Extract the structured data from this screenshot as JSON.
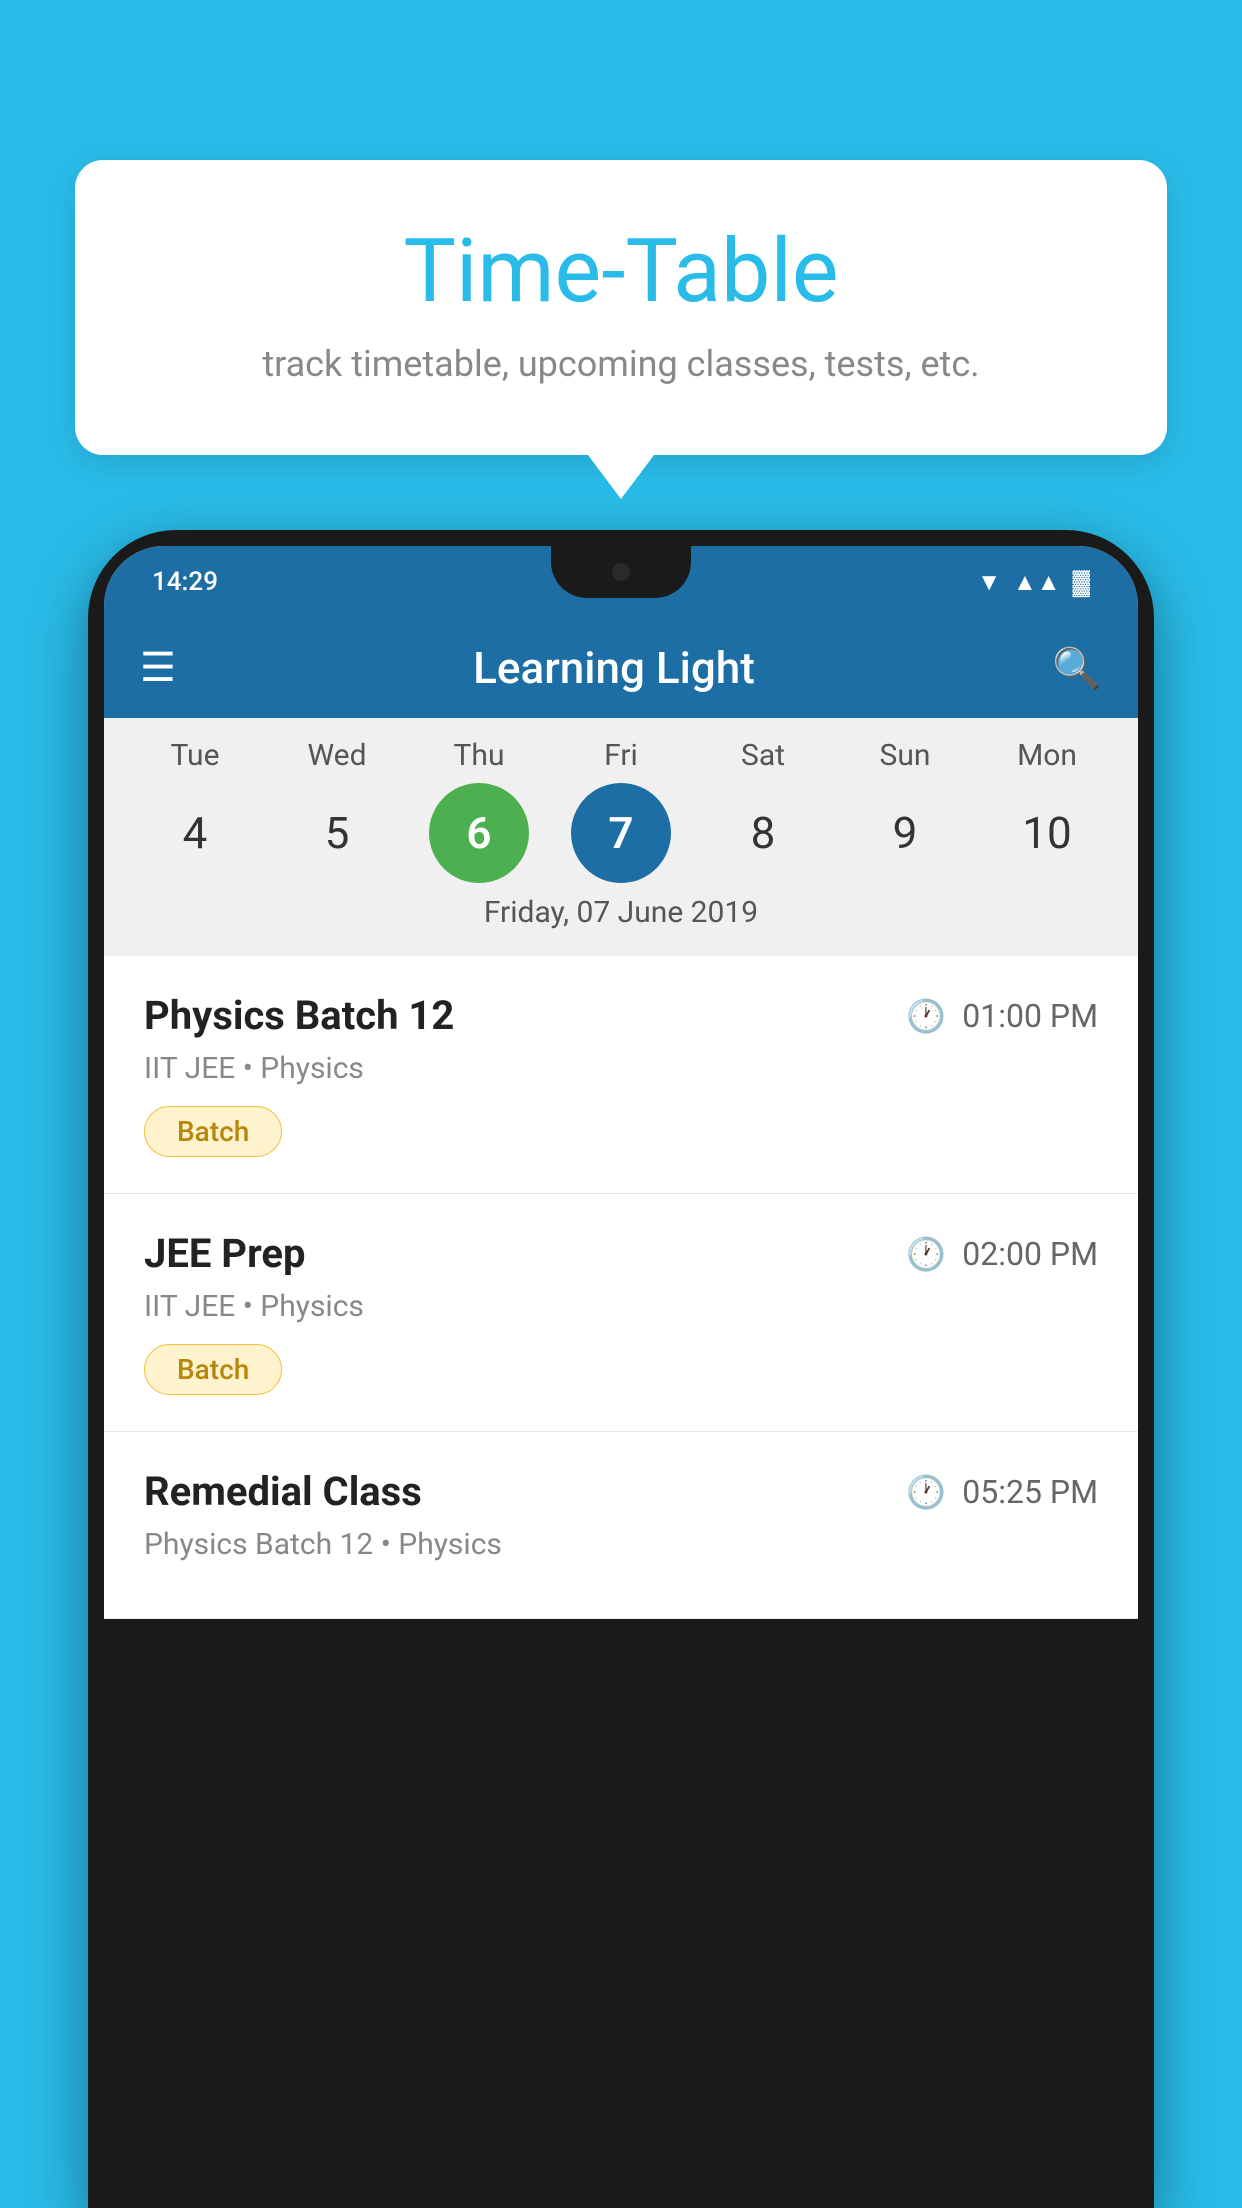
{
  "page": {
    "background_color": "#29bce8"
  },
  "tooltip": {
    "title": "Time-Table",
    "subtitle": "track timetable, upcoming classes, tests, etc."
  },
  "phone": {
    "status_bar": {
      "time": "14:29"
    },
    "toolbar": {
      "title": "Learning Light",
      "hamburger_label": "☰",
      "search_label": "🔍"
    },
    "calendar": {
      "days": [
        {
          "name": "Tue",
          "num": "4",
          "state": "normal"
        },
        {
          "name": "Wed",
          "num": "5",
          "state": "normal"
        },
        {
          "name": "Thu",
          "num": "6",
          "state": "today"
        },
        {
          "name": "Fri",
          "num": "7",
          "state": "selected"
        },
        {
          "name": "Sat",
          "num": "8",
          "state": "normal"
        },
        {
          "name": "Sun",
          "num": "9",
          "state": "normal"
        },
        {
          "name": "Mon",
          "num": "10",
          "state": "normal"
        }
      ],
      "selected_date_label": "Friday, 07 June 2019"
    },
    "schedule": [
      {
        "title": "Physics Batch 12",
        "time": "01:00 PM",
        "subtitle": "IIT JEE • Physics",
        "badge": "Batch"
      },
      {
        "title": "JEE Prep",
        "time": "02:00 PM",
        "subtitle": "IIT JEE • Physics",
        "badge": "Batch"
      },
      {
        "title": "Remedial Class",
        "time": "05:25 PM",
        "subtitle": "Physics Batch 12 • Physics",
        "badge": null
      }
    ]
  }
}
